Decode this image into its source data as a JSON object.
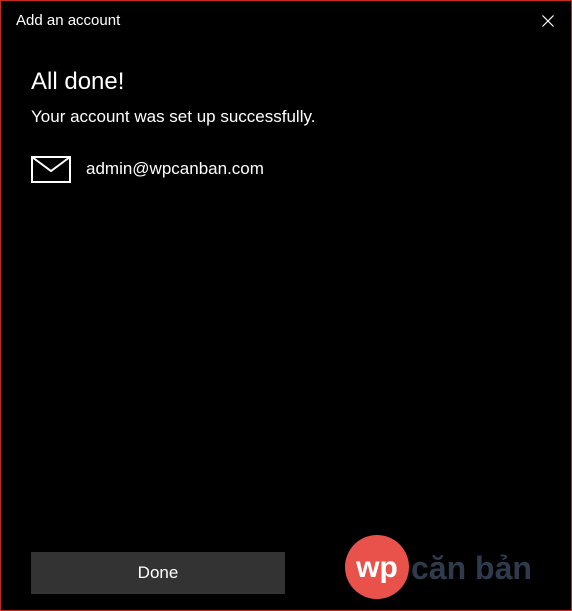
{
  "window": {
    "title": "Add an account",
    "close_icon": "close-icon"
  },
  "content": {
    "heading": "All done!",
    "message": "Your account was set up successfully.",
    "account": {
      "icon": "mail-icon",
      "email": "admin@wpcanban.com"
    }
  },
  "footer": {
    "done_label": "Done"
  },
  "watermark": {
    "logo_prefix": "wp",
    "logo_suffix": "căn bản"
  },
  "colors": {
    "background": "#000000",
    "border_accent": "#c42b1c",
    "button_bg": "#333333",
    "text": "#ffffff",
    "logo_circle": "#e8524a",
    "logo_text": "#2f3b4c"
  }
}
